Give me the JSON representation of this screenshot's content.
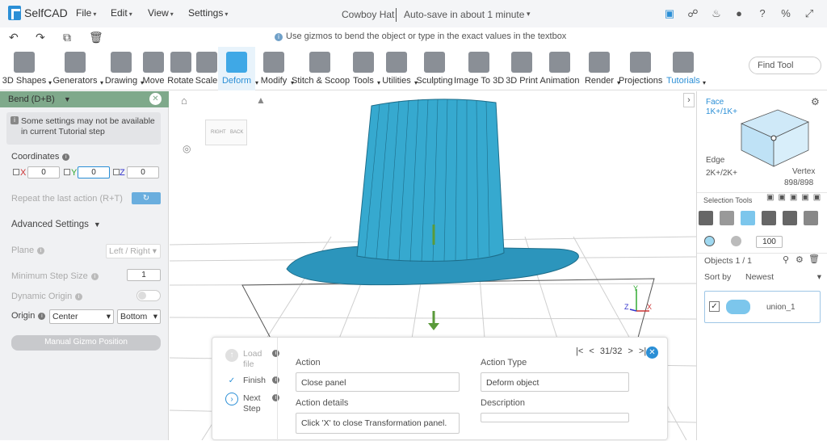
{
  "app": {
    "name": "SelfCAD",
    "doc_title": "Cowboy Hat",
    "autosave": "Auto-save in about 1 minute"
  },
  "menus": [
    "File",
    "Edit",
    "View",
    "Settings"
  ],
  "hint": "Use gizmos to bend the object or type in the exact values in the textbox",
  "toolbar": {
    "tools": [
      {
        "label": "3D Shapes",
        "dropdown": true
      },
      {
        "label": "Generators",
        "dropdown": true
      },
      {
        "label": "Drawing",
        "dropdown": true
      },
      {
        "label": "Move"
      },
      {
        "label": "Rotate"
      },
      {
        "label": "Scale"
      },
      {
        "label": "Deform",
        "dropdown": true,
        "active": true
      },
      {
        "label": "Modify",
        "dropdown": true
      },
      {
        "label": "Stitch & Scoop"
      },
      {
        "label": "Tools",
        "dropdown": true
      },
      {
        "label": "Utilities",
        "dropdown": true
      },
      {
        "label": "Sculpting"
      },
      {
        "label": "Image To 3D"
      },
      {
        "label": "3D Print"
      },
      {
        "label": "Animation"
      },
      {
        "label": "Render",
        "dropdown": true
      },
      {
        "label": "Projections"
      },
      {
        "label": "Tutorials",
        "dropdown": true
      }
    ],
    "find_tool": "Find Tool"
  },
  "left_panel": {
    "header": "Bend (D+B)",
    "warning": "Some settings may not be available in current Tutorial step",
    "coordinates_label": "Coordinates",
    "x_label": "X",
    "x_value": "0",
    "y_label": "Y",
    "y_value": "0",
    "z_label": "Z",
    "z_value": "0",
    "repeat_label": "Repeat the last action (R+T)",
    "advanced_label": "Advanced Settings",
    "plane_label": "Plane",
    "plane_value": "Left / Right",
    "min_step_label": "Minimum Step Size",
    "min_step_value": "1",
    "dynamic_origin_label": "Dynamic Origin",
    "origin_label": "Origin",
    "origin_value1": "Center",
    "origin_value2": "Bottom",
    "manual_gizmo": "Manual Gizmo Position"
  },
  "viewport": {
    "cube_left": "RIGHT",
    "cube_right": "BACK",
    "axis_z": "Z",
    "axis_x": "X",
    "axis_y": "Y"
  },
  "tutorial": {
    "step1": "Load file",
    "step2": "Finish",
    "step3": "Next Step",
    "progress": "31/32",
    "action_label": "Action",
    "action_value": "Close panel",
    "action_type_label": "Action Type",
    "action_type_value": "Deform object",
    "details_label": "Action details",
    "details_value": "Click 'X' to close Transformation panel.",
    "description_label": "Description",
    "description_value": ""
  },
  "right_panel": {
    "face_label": "Face",
    "face_count": "1K+/1K+",
    "edge_label": "Edge",
    "edge_count": "2K+/2K+",
    "vertex_label": "Vertex",
    "vertex_count": "898/898",
    "selection_tools": "Selection Tools",
    "brush_size": "100",
    "objects_label": "Objects 1 / 1",
    "sort_label": "Sort by",
    "sort_value": "Newest",
    "object_name": "union_1"
  },
  "colors": {
    "accent": "#2b8fd6",
    "panel_header": "#7fa98b",
    "hat": "#36a9cf"
  }
}
